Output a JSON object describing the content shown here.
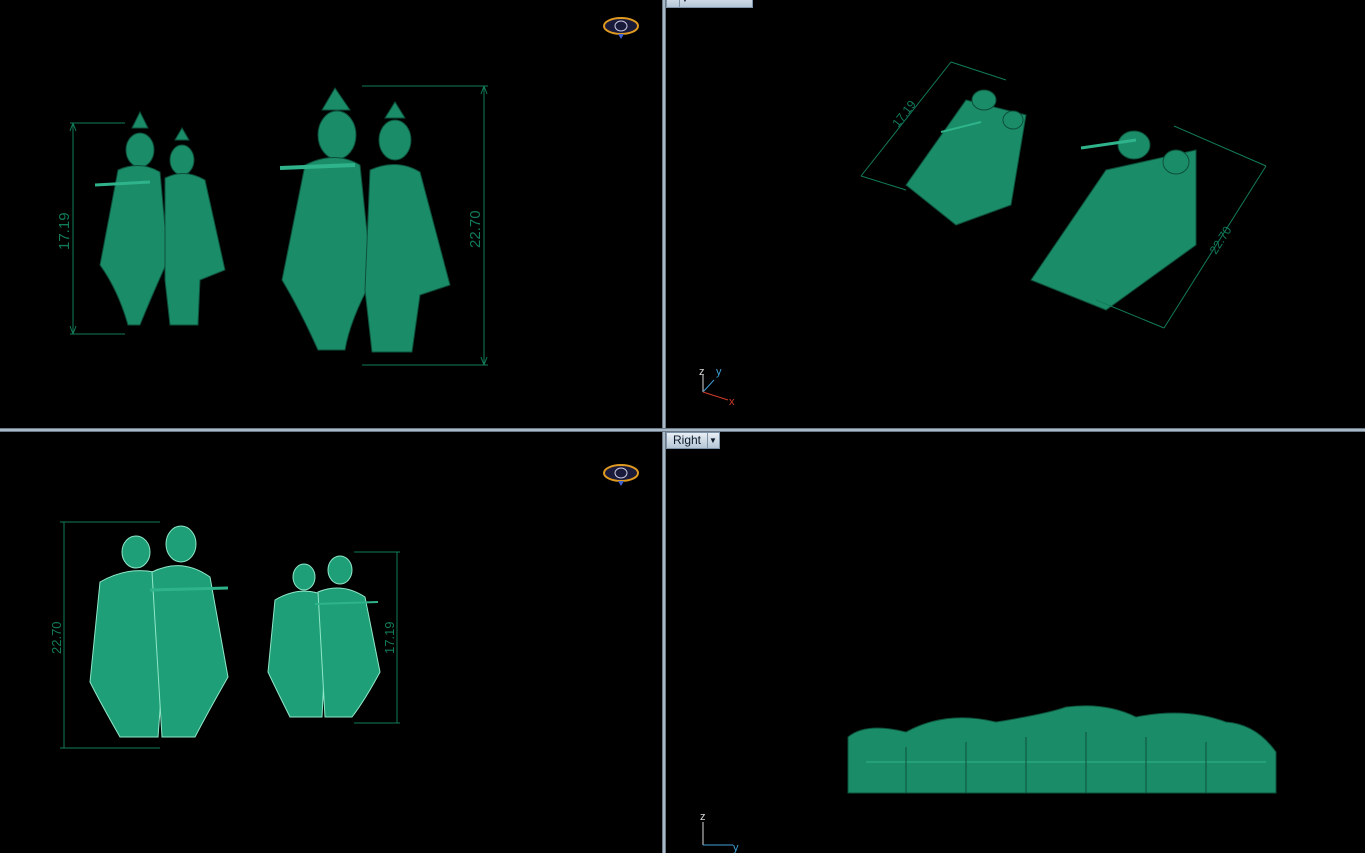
{
  "viewports": {
    "top_left": {
      "dims": [
        "17.19",
        "22.70"
      ],
      "nav_icon": "gizmo-icon"
    },
    "top_right": {
      "view_name": "",
      "dims": [
        "17.19",
        "22.70"
      ],
      "axes": {
        "z": "z",
        "y": "y",
        "x": "x"
      }
    },
    "bottom_left": {
      "dims": [
        "22.70",
        "17.19"
      ],
      "nav_icon": "gizmo-icon"
    },
    "bottom_right": {
      "view_name": "Right",
      "axes": {
        "z": "z",
        "y": "y"
      }
    }
  },
  "colors": {
    "model": "#1b8c68",
    "model_light": "#2fb38a",
    "dim_line": "#127b5a",
    "background": "#000000",
    "axis_x": "#d23a2a",
    "axis_y": "#3fa0d6",
    "axis_z": "#d8d8d8"
  }
}
